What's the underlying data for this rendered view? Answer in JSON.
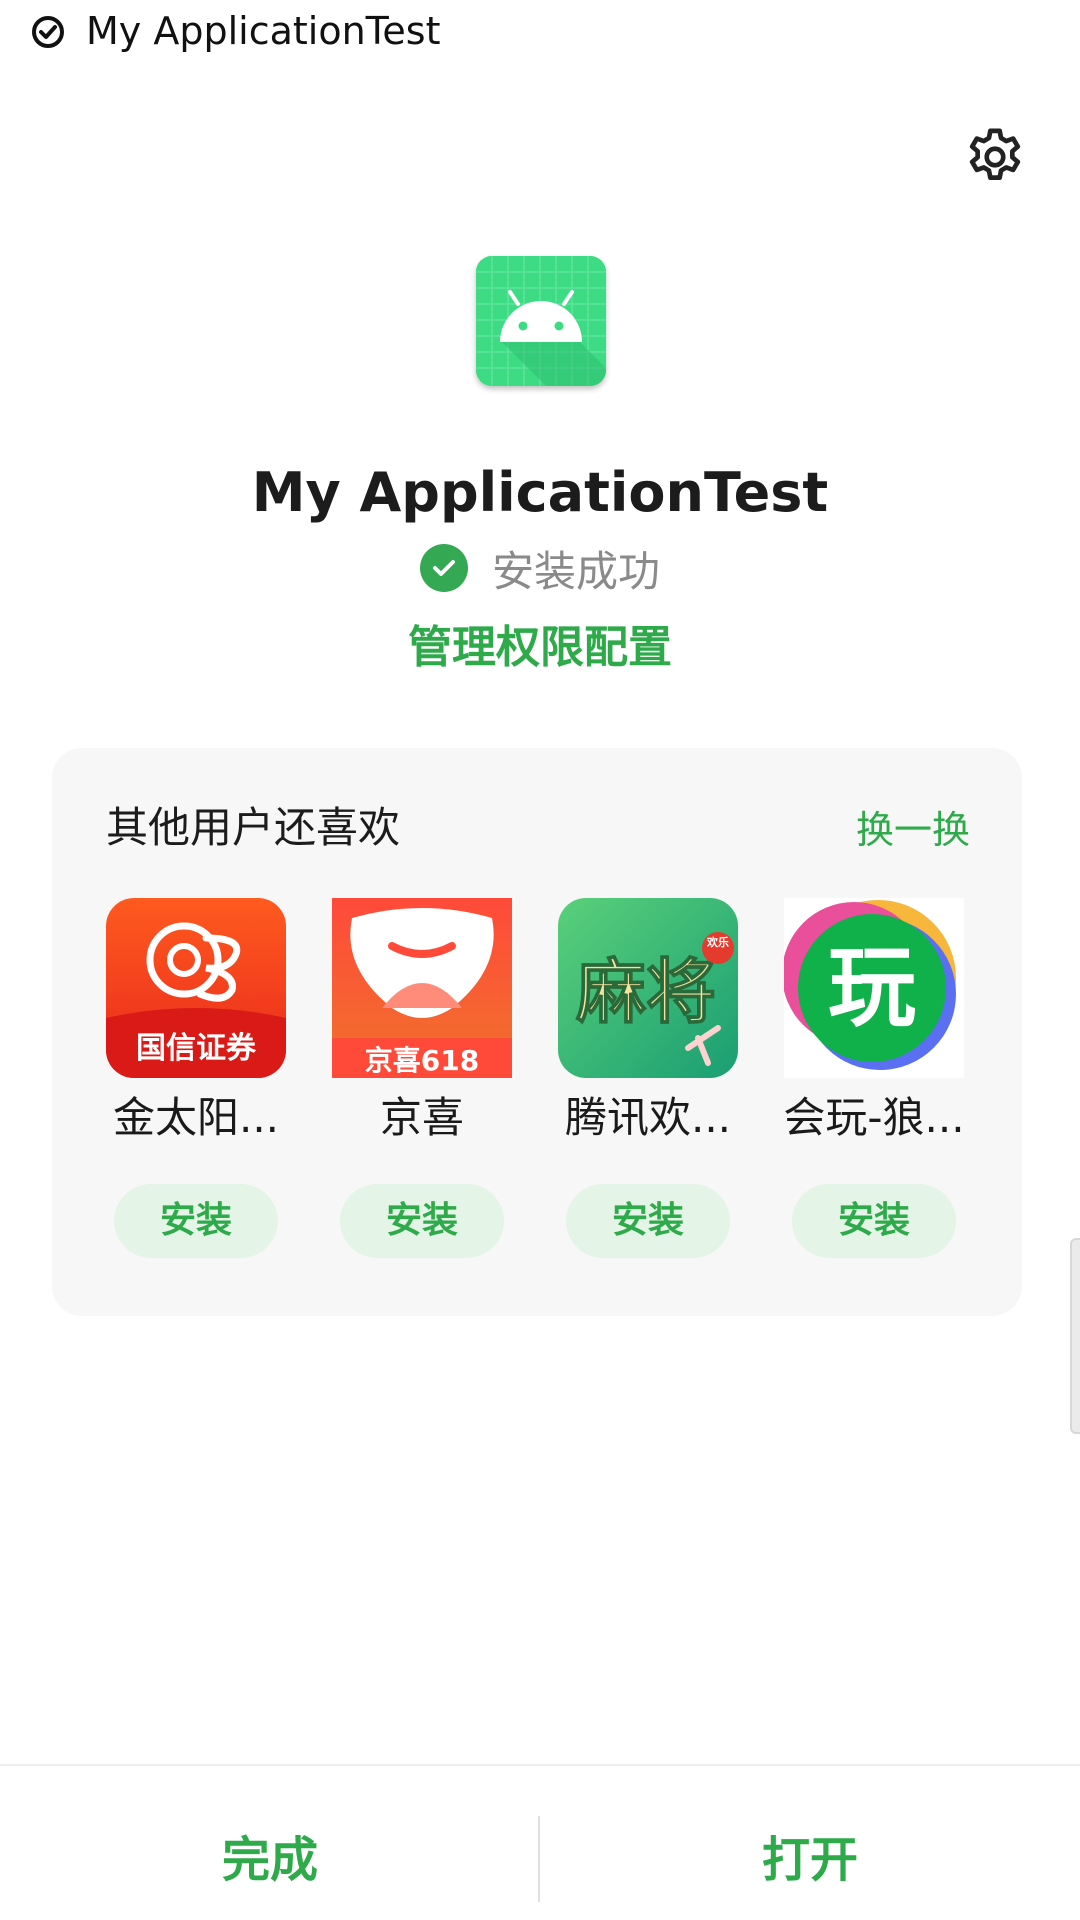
{
  "status_bar": {
    "title": "My ApplicationTest",
    "icon": "check-circle-icon"
  },
  "app": {
    "name": "My ApplicationTest",
    "install_status": "安装成功",
    "manage_permissions": "管理权限配置"
  },
  "recommendations": {
    "title": "其他用户还喜欢",
    "refresh": "换一换",
    "items": [
      {
        "name": "金太阳...",
        "icon_text": "国信证券",
        "install": "安装",
        "icon": "guosen-securities-icon"
      },
      {
        "name": "京喜",
        "icon_text": "京喜618",
        "install": "安装",
        "icon": "jingxi-icon"
      },
      {
        "name": "腾讯欢...",
        "icon_text": "麻将",
        "icon_badge": "欢乐",
        "install": "安装",
        "icon": "mahjong-icon"
      },
      {
        "name": "会玩-狼...",
        "icon_text": "玩",
        "install": "安装",
        "icon": "huiwan-icon"
      }
    ]
  },
  "bottom": {
    "done": "完成",
    "open": "打开"
  },
  "colors": {
    "accent": "#2eaa4a",
    "success": "#34a853",
    "android_green": "#3ddc84"
  }
}
